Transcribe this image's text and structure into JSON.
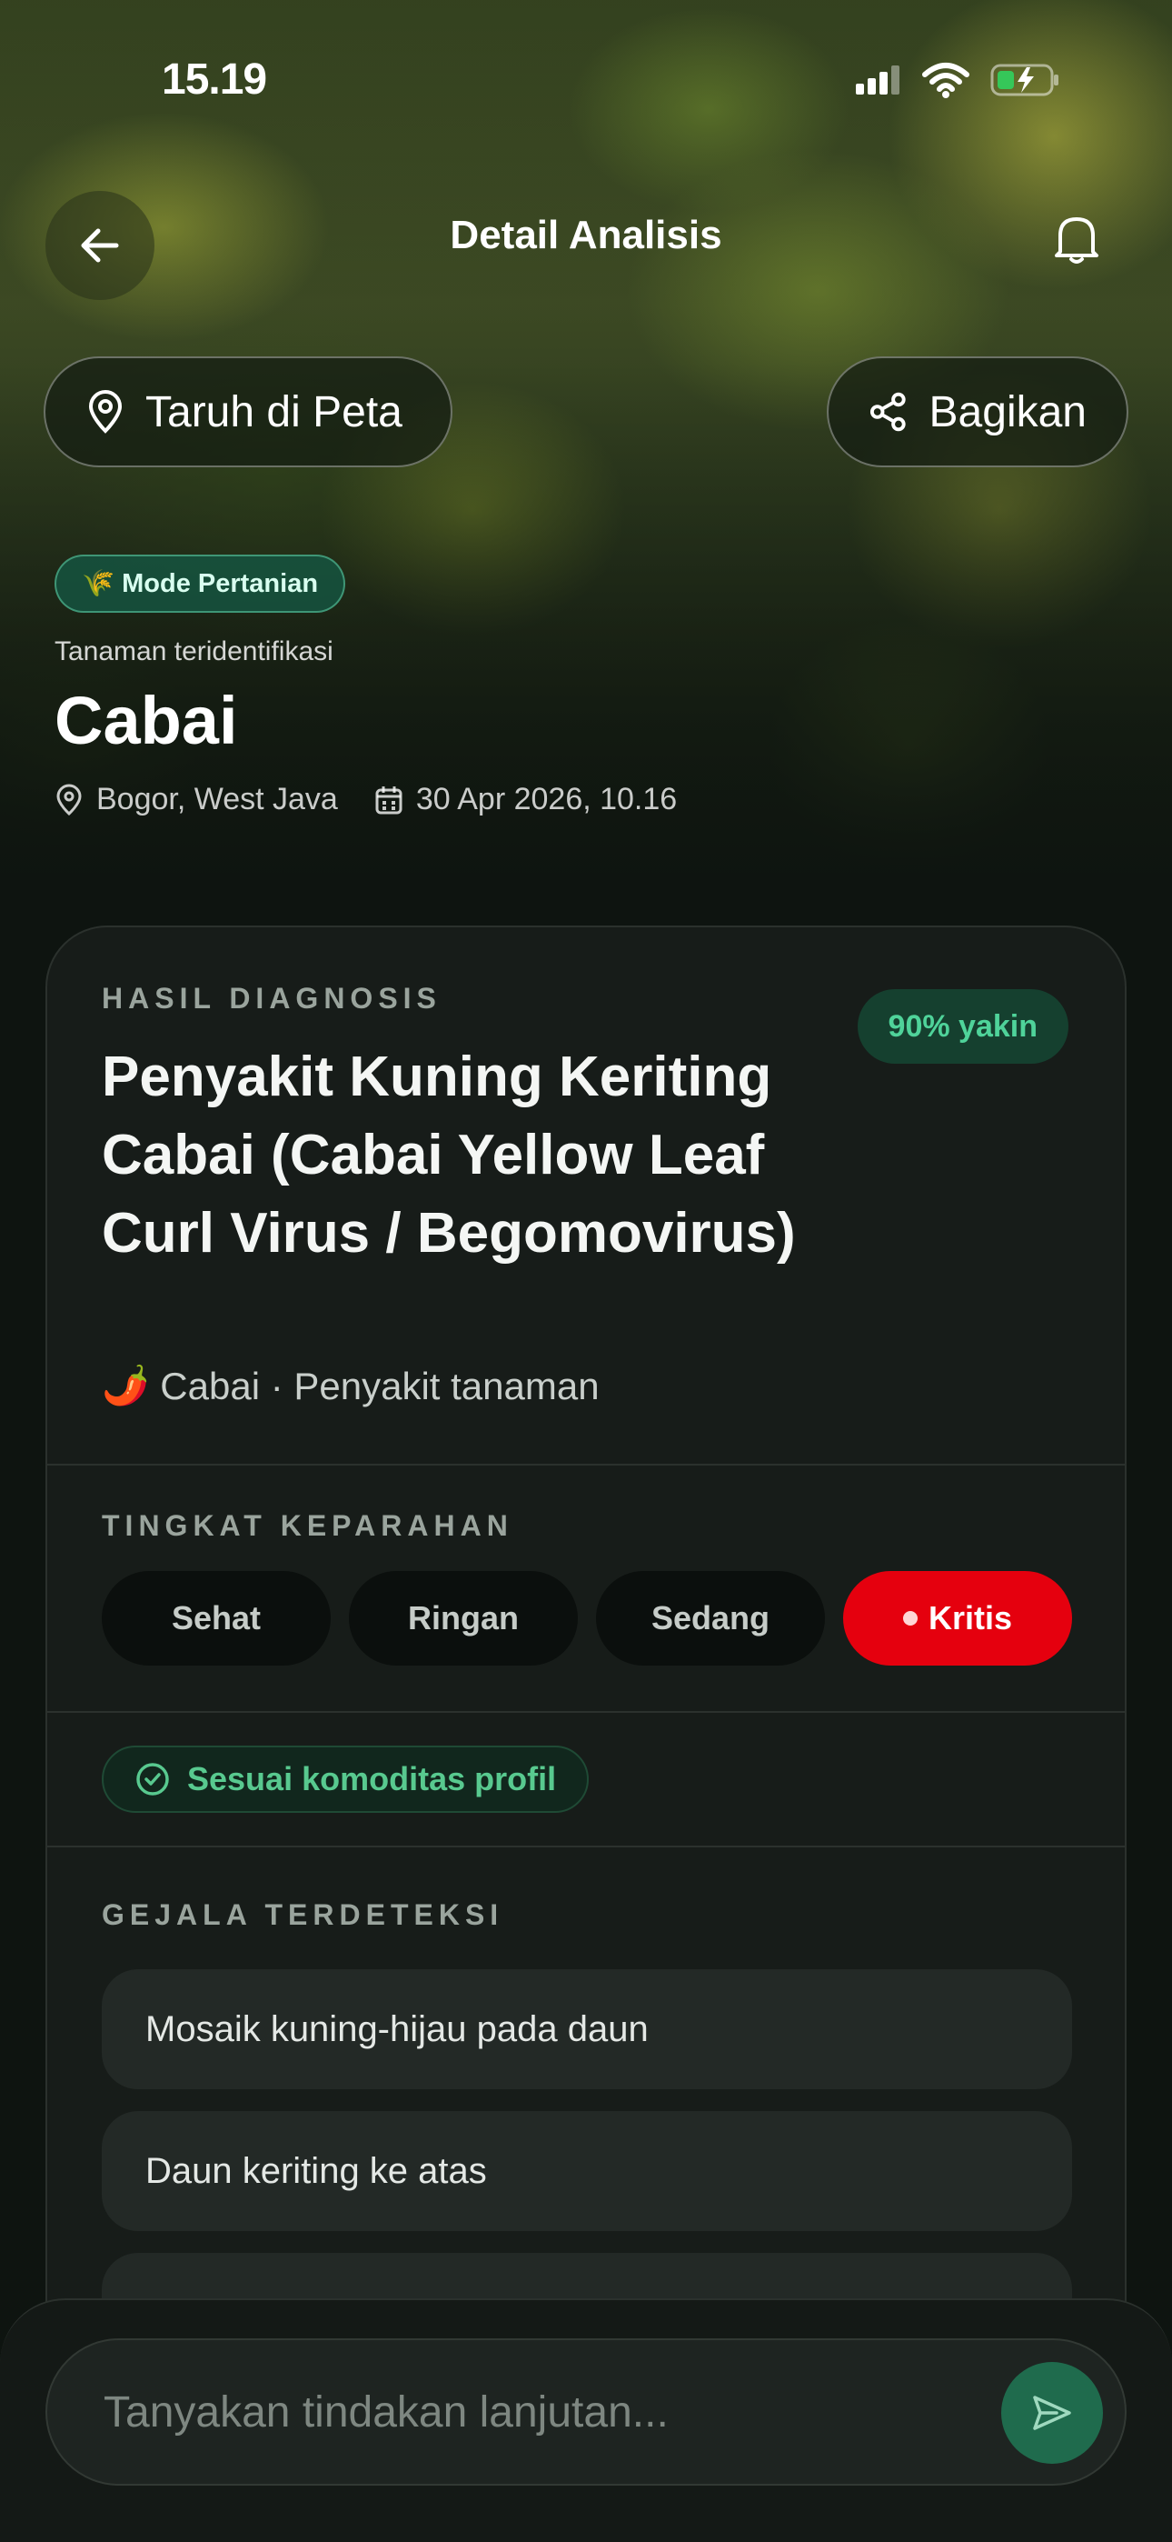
{
  "status_bar": {
    "time": "15.19"
  },
  "header": {
    "title": "Detail Analisis"
  },
  "actions": {
    "map_label": "Taruh di Peta",
    "share_label": "Bagikan"
  },
  "plant": {
    "mode_chip": "Mode Pertanian",
    "mode_emoji": "🌾",
    "identified_label": "Tanaman teridentifikasi",
    "name": "Cabai",
    "location": "Bogor, West Java",
    "datetime": "30 Apr 2026, 10.16"
  },
  "diagnosis": {
    "section_label": "HASIL DIAGNOSIS",
    "confidence": "90% yakin",
    "title": "Penyakit Kuning Keriting Cabai (Cabai Yellow Leaf Curl Virus / Begomovirus)",
    "crop_emoji": "🌶️",
    "subtitle": "Cabai · Penyakit tanaman"
  },
  "severity": {
    "section_label": "TINGKAT KEPARAHAN",
    "levels": [
      "Sehat",
      "Ringan",
      "Sedang",
      "Kritis"
    ],
    "selected": "Kritis",
    "active_color": "#e5000e"
  },
  "profile_match": {
    "label": "Sesuai komoditas profil"
  },
  "symptoms": {
    "section_label": "GEJALA TERDETEKSI",
    "items": [
      "Mosaik kuning-hijau pada daun",
      "Daun keriting ke atas"
    ]
  },
  "chat": {
    "placeholder": "Tanyakan tindakan lanjutan..."
  },
  "colors": {
    "accent_green": "#4fd39a",
    "critical_red": "#e5000e",
    "background": "#0e1410"
  }
}
